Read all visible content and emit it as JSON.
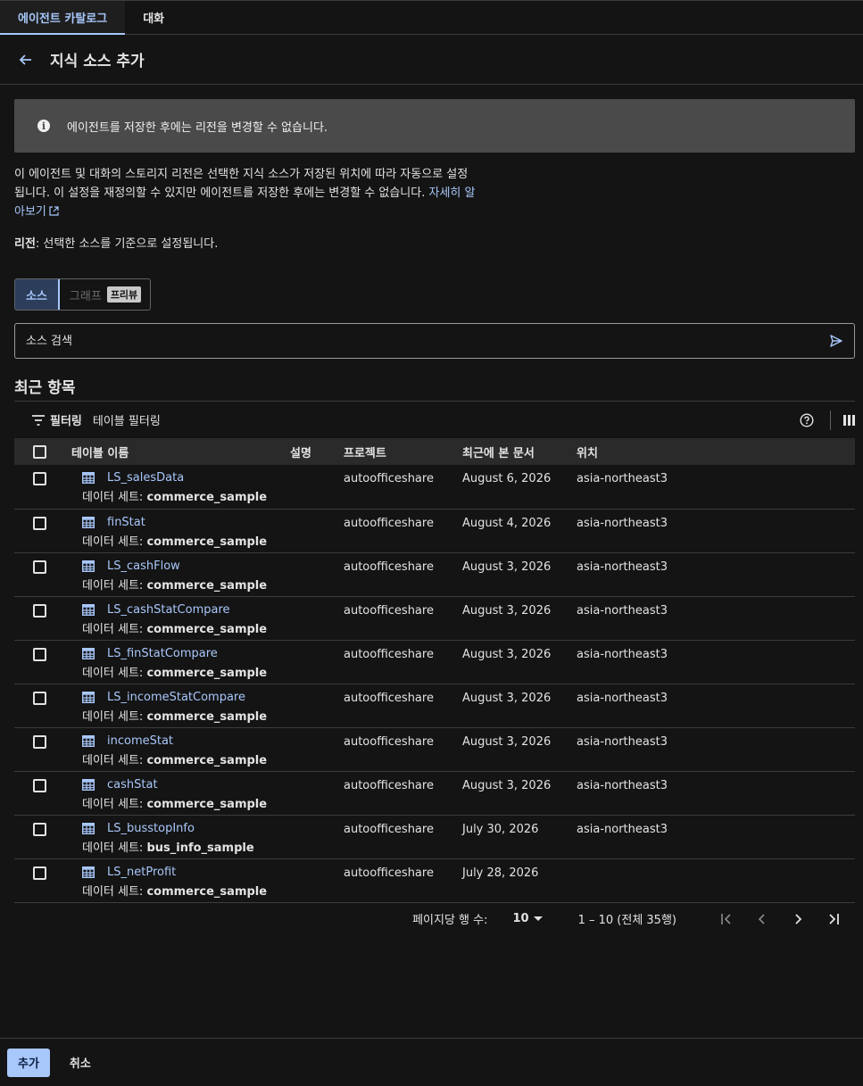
{
  "tabs": [
    {
      "label": "에이전트 카탈로그",
      "active": true
    },
    {
      "label": "대화",
      "active": false
    }
  ],
  "header": {
    "title": "지식 소스 추가"
  },
  "banner": {
    "text": "에이전트를 저장한 후에는 리전을 변경할 수 없습니다."
  },
  "description": {
    "text": "이 에이전트 및 대화의 스토리지 리전은 선택한 지식 소스가 저장된 위치에 따라 자동으로 설정됩니다. 이 설정을 재정의할 수 있지만 에이전트를 저장한 후에는 변경할 수 없습니다. ",
    "link": "자세히 알아보기"
  },
  "region": {
    "label": "리전",
    "text": ": 선택한 소스를 기준으로 설정됩니다."
  },
  "toggle": {
    "source": "소스",
    "graph": "그래프",
    "preview": "프리뷰"
  },
  "search": {
    "placeholder": "소스 검색"
  },
  "recent": {
    "title": "최근 항목"
  },
  "filter": {
    "label": "필터링",
    "placeholder": "테이블 필터링"
  },
  "table": {
    "headers": {
      "name": "테이블 이름",
      "desc": "설명",
      "project": "프로젝트",
      "viewed": "최근에 본 문서",
      "location": "위치"
    },
    "dataset_prefix": "데이터 세트: ",
    "rows": [
      {
        "name": "LS_salesData",
        "dataset": "commerce_sample",
        "desc": "",
        "project": "autoofficeshare",
        "viewed": "August 6, 2026",
        "location": "asia-northeast3"
      },
      {
        "name": "finStat",
        "dataset": "commerce_sample",
        "desc": "",
        "project": "autoofficeshare",
        "viewed": "August 4, 2026",
        "location": "asia-northeast3"
      },
      {
        "name": "LS_cashFlow",
        "dataset": "commerce_sample",
        "desc": "",
        "project": "autoofficeshare",
        "viewed": "August 3, 2026",
        "location": "asia-northeast3"
      },
      {
        "name": "LS_cashStatCompare",
        "dataset": "commerce_sample",
        "desc": "",
        "project": "autoofficeshare",
        "viewed": "August 3, 2026",
        "location": "asia-northeast3"
      },
      {
        "name": "LS_finStatCompare",
        "dataset": "commerce_sample",
        "desc": "",
        "project": "autoofficeshare",
        "viewed": "August 3, 2026",
        "location": "asia-northeast3"
      },
      {
        "name": "LS_incomeStatCompare",
        "dataset": "commerce_sample",
        "desc": "",
        "project": "autoofficeshare",
        "viewed": "August 3, 2026",
        "location": "asia-northeast3"
      },
      {
        "name": "incomeStat",
        "dataset": "commerce_sample",
        "desc": "",
        "project": "autoofficeshare",
        "viewed": "August 3, 2026",
        "location": "asia-northeast3"
      },
      {
        "name": "cashStat",
        "dataset": "commerce_sample",
        "desc": "",
        "project": "autoofficeshare",
        "viewed": "August 3, 2026",
        "location": "asia-northeast3"
      },
      {
        "name": "LS_busstopInfo",
        "dataset": "bus_info_sample",
        "desc": "",
        "project": "autoofficeshare",
        "viewed": "July 30, 2026",
        "location": "asia-northeast3"
      },
      {
        "name": "LS_netProfit",
        "dataset": "commerce_sample",
        "desc": "",
        "project": "autoofficeshare",
        "viewed": "July 28, 2026",
        "location": ""
      }
    ]
  },
  "pagination": {
    "label": "페이지당 행 수:",
    "page_size": "10",
    "range": "1 – 10 (전체 35행)"
  },
  "footer": {
    "add": "추가",
    "cancel": "취소"
  },
  "colors": {
    "accent": "#a8c7fa",
    "background": "#141414",
    "banner": "#4a4a4a"
  }
}
